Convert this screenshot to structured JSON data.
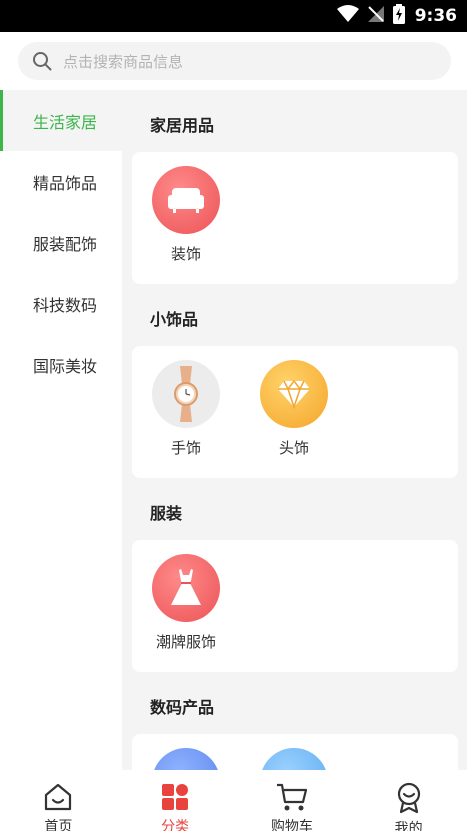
{
  "status_bar": {
    "time": "9:36"
  },
  "search": {
    "placeholder": "点击搜索商品信息"
  },
  "sidebar": {
    "items": [
      {
        "label": "生活家居",
        "active": true
      },
      {
        "label": "精品饰品"
      },
      {
        "label": "服装配饰"
      },
      {
        "label": "科技数码"
      },
      {
        "label": "国际美妆"
      }
    ]
  },
  "sections": [
    {
      "title": "家居用品",
      "items": [
        {
          "label": "装饰",
          "icon": "sofa-icon"
        }
      ]
    },
    {
      "title": "小饰品",
      "items": [
        {
          "label": "手饰",
          "icon": "watch-icon"
        },
        {
          "label": "头饰",
          "icon": "diamond-icon"
        }
      ]
    },
    {
      "title": "服装",
      "items": [
        {
          "label": "潮牌服饰",
          "icon": "dress-icon"
        }
      ]
    },
    {
      "title": "数码产品",
      "items": []
    }
  ],
  "bottom_nav": {
    "items": [
      {
        "label": "首页",
        "icon": "home-icon"
      },
      {
        "label": "分类",
        "icon": "category-icon",
        "active": true
      },
      {
        "label": "购物车",
        "icon": "cart-icon"
      },
      {
        "label": "我的",
        "icon": "profile-icon"
      }
    ]
  },
  "colors": {
    "accent_green": "#3cb54a",
    "accent_red": "#e8443d",
    "background": "#f4f4f4"
  }
}
